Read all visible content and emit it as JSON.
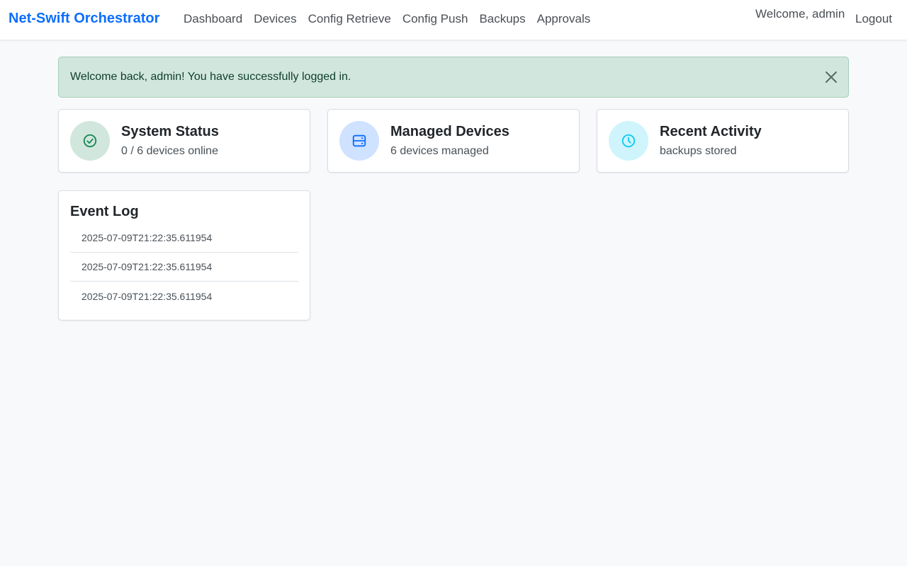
{
  "navbar": {
    "brand": "Net-Swift Orchestrator",
    "links": [
      {
        "label": "Dashboard"
      },
      {
        "label": "Devices"
      },
      {
        "label": "Config Retrieve"
      },
      {
        "label": "Config Push"
      },
      {
        "label": "Backups"
      },
      {
        "label": "Approvals"
      }
    ],
    "welcome": "Welcome, admin",
    "logout": "Logout"
  },
  "alert": {
    "message": "Welcome back, admin! You have successfully logged in.",
    "close_icon": "close-icon"
  },
  "stats": [
    {
      "title": "System Status",
      "subtitle": "0 / 6 devices online",
      "icon": "check-circle-icon",
      "icon_bg": "#d1e7dd",
      "icon_color": "#198754"
    },
    {
      "title": "Managed Devices",
      "subtitle": "6 devices managed",
      "icon": "server-icon",
      "icon_bg": "#cfe2ff",
      "icon_color": "#0d6efd"
    },
    {
      "title": "Recent Activity",
      "subtitle": "backups stored",
      "icon": "clock-icon",
      "icon_bg": "#cff4fc",
      "icon_color": "#0dcaf0"
    }
  ],
  "event_log": {
    "title": "Event Log",
    "entries": [
      "2025-07-09T21:22:35.611954",
      "2025-07-09T21:22:35.611954",
      "2025-07-09T21:22:35.611954"
    ]
  },
  "colors": {
    "brand": "#0d6efd",
    "background": "#f8f9fa",
    "alert_bg": "#d1e7dd"
  }
}
